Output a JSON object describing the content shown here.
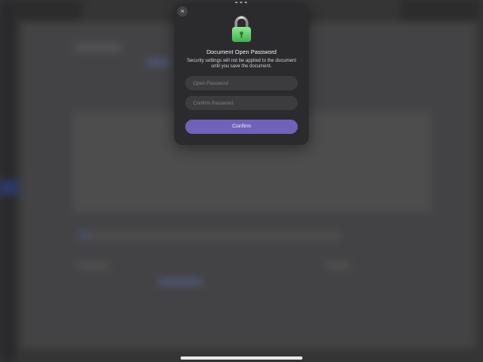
{
  "dialog": {
    "close_label": "×",
    "title": "Document Open Password",
    "description": "Security settings will not be applied to the document until you save the document.",
    "open_password": {
      "value": "",
      "placeholder": "Open Password"
    },
    "confirm_password": {
      "value": "",
      "placeholder": "Confirm Password"
    },
    "confirm_label": "Confirm",
    "icon": "lock-icon"
  },
  "colors": {
    "accent": "#7062b8",
    "dialog_background": "#2b2b2d",
    "lock_green": "#5fd36a"
  }
}
